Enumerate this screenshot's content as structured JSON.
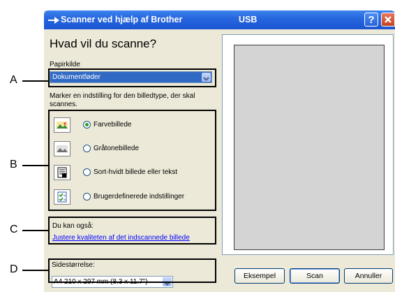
{
  "window": {
    "title": "Scanner ved hjælp af Brother",
    "title_suffix": "USB",
    "help_label": "?"
  },
  "main": {
    "heading": "Hvad vil du scanne?",
    "source_label": "Papirkilde",
    "source_value": "Dokumentføder",
    "instruction_line1": "Marker en indstilling for den billedtype, der skal",
    "instruction_line2": "scannes.",
    "scan_types": [
      {
        "label": "Farvebillede",
        "selected": true,
        "icon": "color-photo-icon"
      },
      {
        "label": "Gråtonebillede",
        "selected": false,
        "icon": "grayscale-photo-icon"
      },
      {
        "label": "Sort-hvidt billede eller tekst",
        "selected": false,
        "icon": "bw-text-icon"
      },
      {
        "label": "Brugerdefinerede indstillinger",
        "selected": false,
        "icon": "custom-settings-icon"
      }
    ],
    "also_label": "Du kan også:",
    "adjust_link": "Justere kvaliteten af det indscannede billede",
    "page_size_label": "Sidestørrelse:",
    "page_size_value": "A4 210 x 297 mm (8.3 x 11.7\")"
  },
  "buttons": {
    "preview": "Eksempel",
    "scan": "Scan",
    "cancel": "Annuller"
  },
  "callouts": [
    "A",
    "B",
    "C",
    "D"
  ],
  "colors": {
    "titlebar": "#2767df",
    "dialog_bg": "#ece9d8",
    "selection": "#316ac5",
    "link": "#0000ff"
  }
}
